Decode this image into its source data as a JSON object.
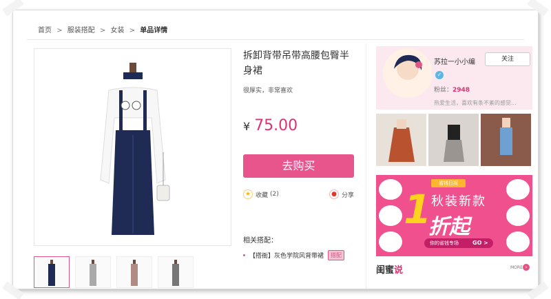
{
  "breadcrumb": [
    "首页",
    "服装搭配",
    "女装",
    "单品详情"
  ],
  "breadcrumb_sep": ">",
  "product": {
    "title": "拆卸背带吊带高腰包臀半身裙",
    "subtitle": "很厚实，非常喜欢",
    "currency": "¥",
    "price": "75.00",
    "buy_label": "去购买",
    "fav_label": "收藏",
    "fav_count": "(2)",
    "share_label": "分享",
    "related_title": "相关搭配：",
    "related_item": "【搭衙】灰色学院风背带裙",
    "related_badge": "搭配"
  },
  "user": {
    "name": "苏拉一小小编",
    "follow_label": "关注",
    "fans_label": "粉丝：",
    "fans_count": "2948",
    "bio": "热爱生活，喜欢有条不紊的感觉..."
  },
  "banner": {
    "tag": "省钱日报",
    "digit": "1",
    "headline": "秋装新款",
    "subline": "折起",
    "footer": "你的省钱专场",
    "go": "GO >"
  },
  "section": {
    "title_a": "闺蜜",
    "title_b": "说",
    "more": "MORE"
  },
  "colors": {
    "accent": "#e8558c",
    "price": "#e03074",
    "card_bg": "#fbe9ef"
  }
}
